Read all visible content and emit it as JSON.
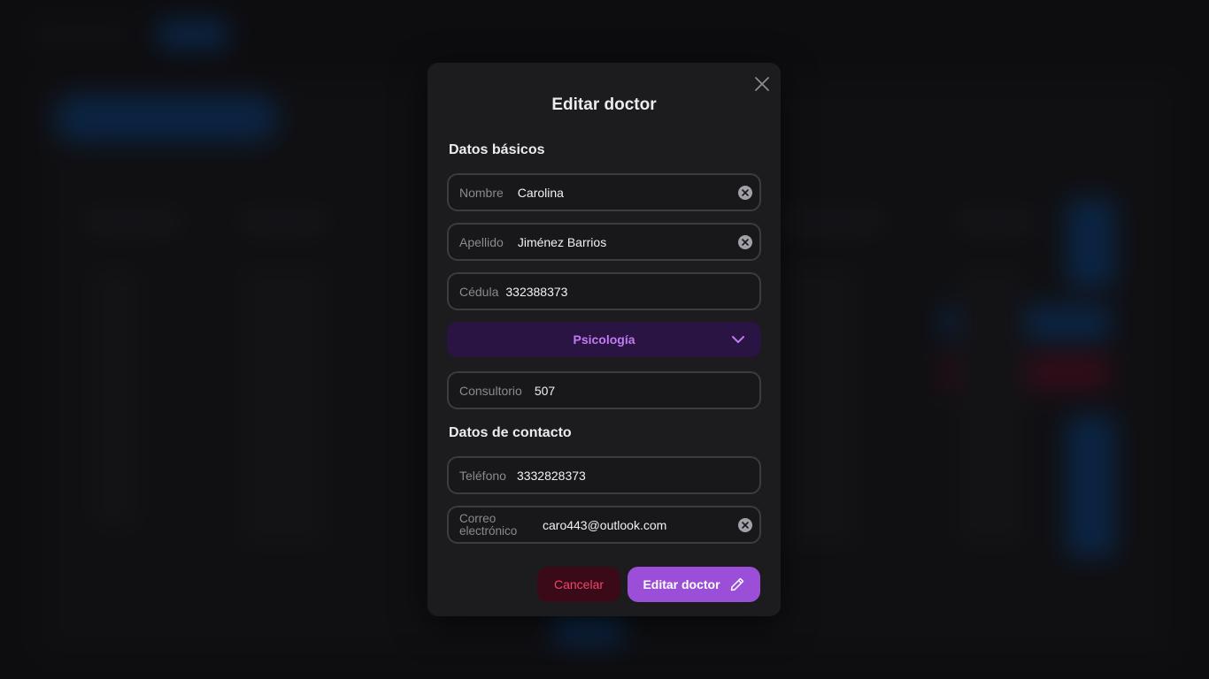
{
  "colors": {
    "accent": "#9b4fd8",
    "select_bg": "#2a1443",
    "select_text": "#c07cf0",
    "cancel_bg": "#3b0a18",
    "cancel_text": "#f0456f",
    "modal_bg": "#1c1c1f"
  },
  "modal": {
    "title": "Editar doctor",
    "close_icon": "close-icon",
    "basic_section": "Datos básicos",
    "contact_section": "Datos de contacto"
  },
  "fields": {
    "nombre": {
      "label": "Nombre",
      "value": "Carolina"
    },
    "apellido": {
      "label": "Apellido",
      "value": "Jiménez Barrios"
    },
    "cedula": {
      "label": "Cédula",
      "value": "332388373"
    },
    "especialidad": {
      "value": "Psicología",
      "icon": "chevron-down-icon"
    },
    "consultorio": {
      "label": "Consultorio",
      "value": "507"
    },
    "telefono": {
      "label": "Teléfono",
      "value": "3332828373"
    },
    "correo": {
      "label": "Correo electrónico",
      "value": "caro443@outlook.com"
    }
  },
  "actions": {
    "cancel_label": "Cancelar",
    "submit_label": "Editar doctor",
    "submit_icon": "pencil-icon"
  }
}
